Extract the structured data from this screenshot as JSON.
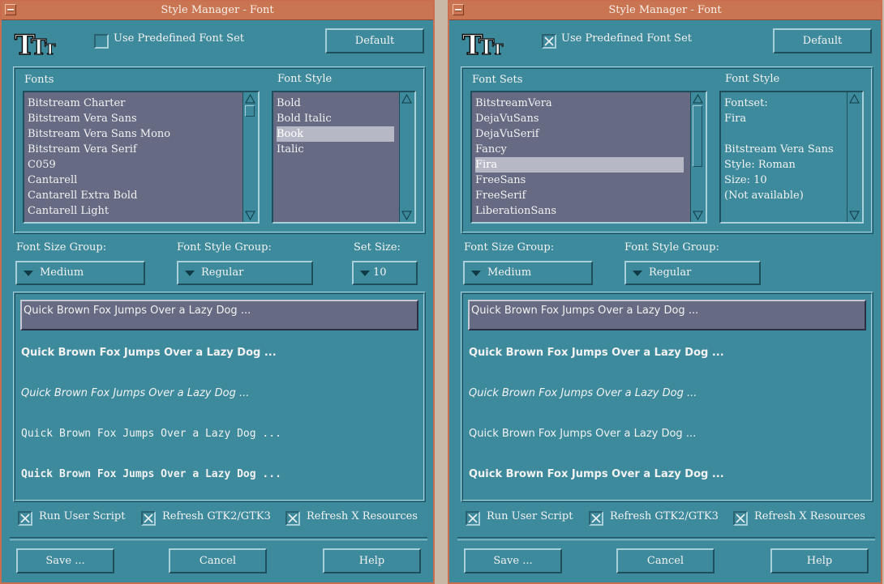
{
  "windows": [
    {
      "title": "Style Manager - Font",
      "logo_text": "TTT",
      "use_predefined": {
        "label": "Use Predefined Font Set",
        "checked": false
      },
      "default_label": "Default",
      "left_list": {
        "heading": "Fonts",
        "items": [
          "Bitstream Charter",
          "Bitstream Vera Sans",
          "Bitstream Vera Sans Mono",
          "Bitstream Vera Serif",
          "C059",
          "Cantarell",
          "Cantarell Extra Bold",
          "Cantarell Light"
        ],
        "selected": -1
      },
      "style_list": {
        "heading": "Font Style",
        "items": [
          "Bold",
          "Bold Italic",
          "Book",
          "Italic"
        ],
        "selected": 2
      },
      "size_group": {
        "label": "Font Size Group:",
        "value": "Medium"
      },
      "style_group": {
        "label": "Font Style Group:",
        "value": "Regular"
      },
      "set_size": {
        "label": "Set Size:",
        "value": "10"
      },
      "preview_input": "Quick Brown Fox Jumps Over a Lazy Dog ...",
      "previews": [
        "Quick Brown Fox Jumps Over a Lazy Dog ...",
        "Quick Brown Fox Jumps Over a Lazy Dog ...",
        "Quick Brown Fox Jumps Over a Lazy Dog ...",
        "Quick Brown Fox Jumps Over a Lazy Dog ..."
      ],
      "checks": [
        {
          "label": "Run User Script",
          "checked": true
        },
        {
          "label": "Refresh GTK2/GTK3",
          "checked": true
        },
        {
          "label": "Refresh X Resources",
          "checked": true
        }
      ],
      "buttons": {
        "save": "Save ...",
        "cancel": "Cancel",
        "help": "Help"
      }
    },
    {
      "title": "Style Manager - Font",
      "logo_text": "TTT",
      "use_predefined": {
        "label": "Use Predefined Font Set",
        "checked": true
      },
      "default_label": "Default",
      "left_list": {
        "heading": "Font Sets",
        "items": [
          "BitstreamVera",
          "DejaVuSans",
          "DejaVuSerif",
          "Fancy",
          "Fira",
          "FreeSans",
          "FreeSerif",
          "LiberationSans"
        ],
        "selected": 4
      },
      "style_list": {
        "heading": "Font Style",
        "items": [
          "Fontset:",
          "Fira",
          "",
          "Bitstream Vera Sans",
          "Style: Roman",
          "Size: 10",
          "(Not available)"
        ],
        "selected": -1
      },
      "size_group": {
        "label": "Font Size Group:",
        "value": "Medium"
      },
      "style_group": {
        "label": "Font Style Group:",
        "value": "Regular"
      },
      "preview_input": "Quick Brown Fox Jumps Over a Lazy Dog ...",
      "previews": [
        "Quick Brown Fox Jumps Over a Lazy Dog ...",
        "Quick Brown Fox Jumps Over a Lazy Dog ...",
        "Quick Brown Fox Jumps Over a Lazy Dog ...",
        "Quick Brown Fox Jumps Over a Lazy Dog ..."
      ],
      "checks": [
        {
          "label": "Run User Script",
          "checked": true
        },
        {
          "label": "Refresh GTK2/GTK3",
          "checked": true
        },
        {
          "label": "Refresh X Resources",
          "checked": true
        }
      ],
      "buttons": {
        "save": "Save ...",
        "cancel": "Cancel",
        "help": "Help"
      }
    }
  ],
  "colors": {
    "window_bg": "#3d8a9c",
    "titlebar": "#c97552",
    "list_bg": "#666a82",
    "selection": "#b6b8c6"
  }
}
